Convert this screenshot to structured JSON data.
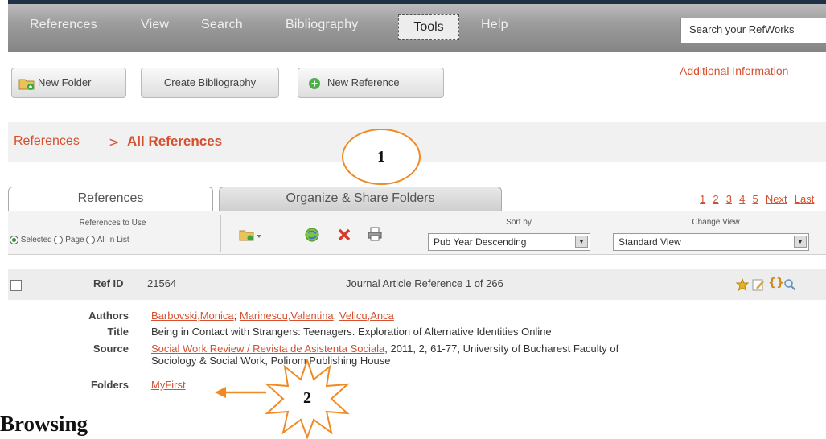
{
  "nav": {
    "items": [
      "References",
      "View",
      "Search",
      "Bibliography",
      "Tools",
      "Help"
    ],
    "search_placeholder": "Search your RefWorks"
  },
  "toolbar_buttons": {
    "new_folder": "New Folder",
    "create_bibliography": "Create Bibliography",
    "new_reference": "New Reference"
  },
  "additional_info": "Additional Information",
  "breadcrumb": {
    "root": "References",
    "separator": ">",
    "current": "All References"
  },
  "tabs": [
    "References",
    "Organize & Share Folders"
  ],
  "pager": [
    "1",
    "2",
    "3",
    "4",
    "5",
    "Next",
    "Last"
  ],
  "references_to_use": {
    "label": "References to Use",
    "options": [
      "Selected",
      "Page",
      "All in List"
    ],
    "selected": "Selected"
  },
  "sort": {
    "label": "Sort by",
    "value": "Pub Year Descending"
  },
  "change_view": {
    "label": "Change View",
    "value": "Standard View"
  },
  "reference": {
    "refid_label": "Ref ID",
    "refid": "21564",
    "type_text": "Journal Article Reference 1 of 266",
    "authors_label": "Authors",
    "authors": [
      "Barbovski,Monica",
      "Marinescu,Valentina",
      "Vellcu,Anca"
    ],
    "title_label": "Title",
    "title": "Being in Contact with Strangers: Teenagers. Exploration of Alternative Identities Online",
    "source_label": "Source",
    "source_link": "Social Work Review / Revista de Asistenta Sociala",
    "source_rest": ", 2011, 2, 61-77, University of Bucharest Faculty of",
    "source_line2": "Sociology & Social Work, Polirom Publishing House",
    "folders_label": "Folders",
    "folder": "MyFirst"
  },
  "annotations": {
    "circle": "1",
    "starburst": "2",
    "accent_color": "#f08a24"
  },
  "caption": "Browsing"
}
